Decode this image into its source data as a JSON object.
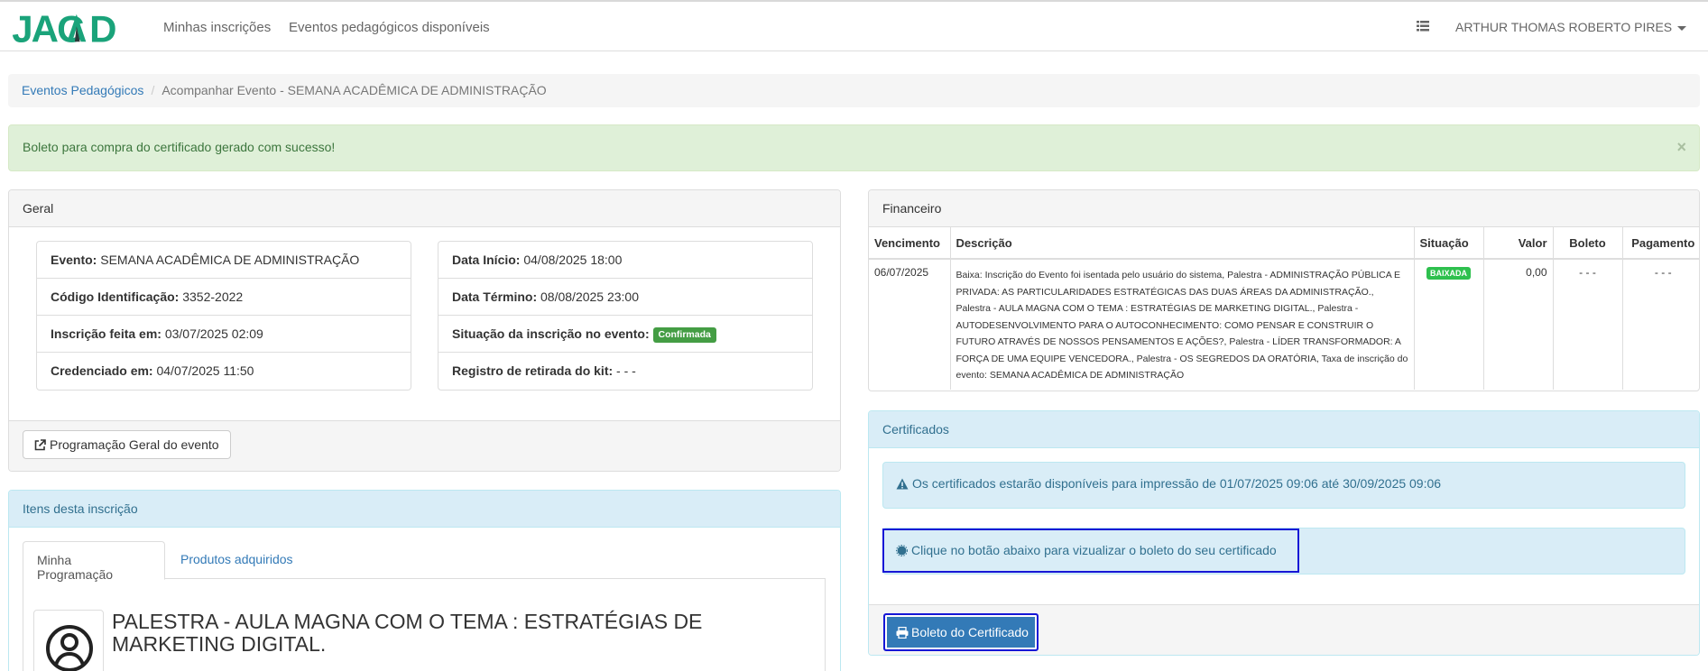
{
  "brand": {
    "logo_text": "JACAD",
    "logo_color": "#1aa37a"
  },
  "nav": {
    "links": [
      "Minhas inscrições",
      "Eventos pedagógicos disponíveis"
    ],
    "user": "ARTHUR THOMAS ROBERTO PIRES"
  },
  "breadcrumb": {
    "root": "Eventos Pedagógicos",
    "separator": "/",
    "current": "Acompanhar Evento - SEMANA ACADÊMICA DE ADMINISTRAÇÃO"
  },
  "alert": {
    "message": "Boleto para compra do certificado gerado com sucesso!",
    "close": "×"
  },
  "geral": {
    "heading": "Geral",
    "left": [
      {
        "label": "Evento:",
        "value": "SEMANA ACADÊMICA DE ADMINISTRAÇÃO"
      },
      {
        "label": "Código Identificação:",
        "value": "3352-2022"
      },
      {
        "label": "Inscrição feita em:",
        "value": "03/07/2025 02:09"
      },
      {
        "label": "Credenciado em:",
        "value": "04/07/2025 11:50"
      }
    ],
    "right": [
      {
        "label": "Data Início:",
        "value": "04/08/2025 18:00"
      },
      {
        "label": "Data Término:",
        "value": "08/08/2025 23:00"
      },
      {
        "label": "Situação da inscrição no evento:",
        "badge": "Confirmada"
      },
      {
        "label": "Registro de retirada do kit:",
        "value": "- - -"
      }
    ],
    "program_button": "Programação Geral do evento"
  },
  "itens": {
    "heading": "Itens desta inscrição",
    "tabs": [
      "Minha Programação",
      "Produtos adquiridos"
    ],
    "event_title": "PALESTRA - AULA MAGNA COM O TEMA : ESTRATÉGIAS DE MARKETING DIGITAL."
  },
  "financeiro": {
    "heading": "Financeiro",
    "columns": [
      "Vencimento",
      "Descrição",
      "Situação",
      "Valor",
      "Boleto",
      "Pagamento"
    ],
    "rows": [
      {
        "vencimento": "06/07/2025",
        "descricao": "Baixa: Inscrição do Evento foi isentada pelo usuário do sistema, Palestra - ADMINISTRAÇÃO PÚBLICA E PRIVADA: AS PARTICULARIDADES ESTRATÉGICAS DAS DUAS ÁREAS DA ADMINISTRAÇÃO., Palestra - AULA MAGNA COM O TEMA : ESTRATÉGIAS DE MARKETING DIGITAL., Palestra - AUTODESENVOLVIMENTO PARA O AUTOCONHECIMENTO: COMO PENSAR E CONSTRUIR O FUTURO ATRAVÉS DE NOSSOS PENSAMENTOS E AÇÕES?, Palestra - LÍDER TRANSFORMADOR: A FORÇA DE UMA EQUIPE VENCEDORA., Palestra - OS SEGREDOS DA ORATÓRIA, Taxa de inscrição do evento: SEMANA ACADÊMICA DE ADMINISTRAÇÃO",
        "situacao": "BAIXADA",
        "valor": "0,00",
        "boleto": "- - -",
        "pagamento": "- - -"
      }
    ]
  },
  "certificados": {
    "heading": "Certificados",
    "info": "Os certificados estarão disponíveis para impressão de 01/07/2025 09:06 até 30/09/2025 09:06",
    "hint": "Clique no botão abaixo para vizualizar o boleto do seu certificado",
    "button": "Boleto do Certificado"
  }
}
